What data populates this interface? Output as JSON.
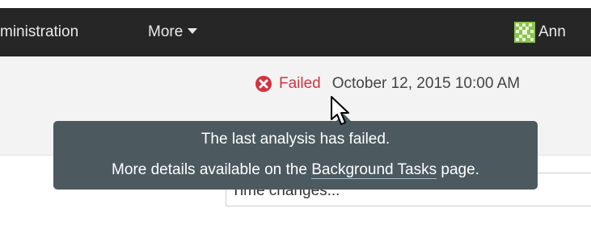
{
  "nav": {
    "admin_label": "ministration",
    "more_label": "More",
    "user_name": "Ann"
  },
  "status": {
    "icon": "x-circle-icon",
    "label": "Failed",
    "date": "October 12, 2015 10:00 AM"
  },
  "tooltip": {
    "line1": "The last analysis has failed.",
    "line2_prefix": "More details available on the",
    "link_label": "Background Tasks",
    "line2_suffix": "page."
  },
  "search": {
    "value": "Time changes..."
  },
  "colors": {
    "topbar": "#262626",
    "failed": "#d4333f",
    "tooltip_bg": "#4c5a60",
    "subheader_bg": "#f3f3f3"
  }
}
